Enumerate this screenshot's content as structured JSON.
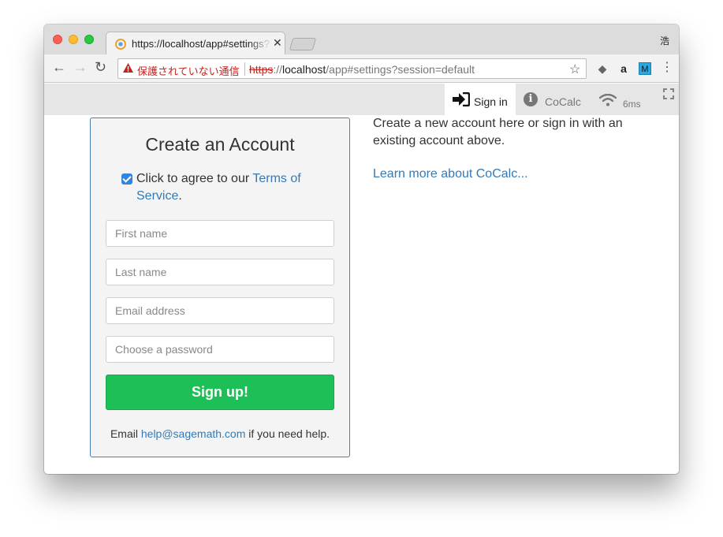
{
  "browser": {
    "tab_title": "https://localhost/app#settings?session=default",
    "tab_close": "✕",
    "profile_label": "浩",
    "security_label": "保護されていない通信",
    "url_scheme": "https",
    "url_sep": "://",
    "url_host": "localhost",
    "url_path": "/app#settings?session=default",
    "star_icon": "star-icon",
    "extensions": [
      "evernote-icon",
      "amazon-icon",
      "m-extension-icon"
    ],
    "ext_m_label": "M",
    "ext_amazon_label": "a"
  },
  "topnav": {
    "signin_label": "Sign in",
    "cocalc_label": "CoCalc",
    "ping_label": "6ms"
  },
  "signup": {
    "title": "Create an Account",
    "terms_checked": true,
    "terms_prefix": "Click to agree to our ",
    "terms_link": "Terms of Service",
    "terms_suffix": ".",
    "first_name_placeholder": "First name",
    "last_name_placeholder": "Last name",
    "email_placeholder": "Email address",
    "password_placeholder": "Choose a password",
    "button_label": "Sign up!",
    "help_prefix": "Email ",
    "help_email": "help@sagemath.com",
    "help_suffix": " if you need help."
  },
  "info": {
    "text": "Create a new account here or sign in with an existing account above.",
    "learn_more": "Learn more about CoCalc..."
  },
  "colors": {
    "accent": "#337ab7",
    "signup_button": "#1dc057",
    "security_warning": "#c5221f"
  }
}
